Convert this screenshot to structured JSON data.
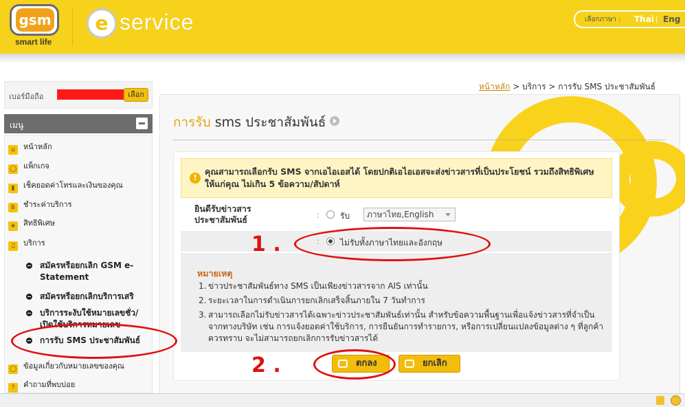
{
  "header": {
    "logo_text": "gsm",
    "tagline": "smart life",
    "service_brand": "service",
    "lang_label": "เลือกภาษา :",
    "lang_thai": "Thai",
    "lang_eng": "Eng"
  },
  "sidebar": {
    "phone_label": "เบอร์มือถือ",
    "phone_button": "เลือก",
    "menu_title": "เมนู",
    "items": [
      {
        "label": "หน้าหลัก",
        "icon": "home-icon"
      },
      {
        "label": "แพ็กเกจ",
        "icon": "chat-icon"
      },
      {
        "label": "เช็คยอดค่าโทรและเงินของคุณ",
        "icon": "phone-icon"
      },
      {
        "label": "ชำระค่าบริการ",
        "icon": "baht-icon"
      },
      {
        "label": "สิทธิพิเศษ",
        "icon": "star-icon"
      },
      {
        "label": "บริการ",
        "icon": "music-icon"
      }
    ],
    "subitems": [
      {
        "label": "สมัครหรือยกเลิก GSM e-Statement"
      },
      {
        "label": "สมัครหรือยกเลิกบริการเสริ"
      },
      {
        "label": "บริการระงับใช้หมายเลขชั่ว/เปิดใช้บริการหมายเลข"
      },
      {
        "label": "การรับ SMS ประชาสัมพันธ์"
      }
    ],
    "bottom_items": [
      {
        "label": "ข้อมูลเกี่ยวกับหมายเลขของคุณ",
        "icon": "chat-icon"
      },
      {
        "label": "คำถามที่พบบ่อย",
        "icon": "question-icon"
      }
    ]
  },
  "breadcrumb": {
    "home": "หน้าหลัก",
    "rest": " > บริการ > การรับ SMS ประชาสัมพันธ์"
  },
  "page": {
    "title_prefix": "การรับ",
    "title_rest": " sms ประชาสัมพันธ์",
    "notice": "คุณสามารถเลือกรับ SMS จากเอไอเอสได้ โดยปกติเอไอเอสจะส่งข่าวสารที่เป็นประโยชน์ รวมถึงสิทธิพิเศษให้แก่คุณ ไม่เกิน 5 ข้อความ/สัปดาห์",
    "field_label": "ยินดีรับข่าวสารประชาสัมพันธ์",
    "colon": ":",
    "option_receive": "รับ",
    "option_receive_select": "ภาษาไทย,English",
    "option_decline": "ไม่รับทั้งภาษาไทยและอังกฤษ",
    "remark_title": "หมายเหตุ",
    "remarks": [
      {
        "n": "1.",
        "text": "ข่าวประชาสัมพันธ์ทาง SMS เป็นเพียงข่าวสารจาก AIS เท่านั้น"
      },
      {
        "n": "2.",
        "text": "ระยะเวลาในการดำเนินการยกเลิกเสร็จสิ้นภายใน 7 วันทำการ"
      },
      {
        "n": "3.",
        "text": "สามารถเลือกไม่รับข่าวสารได้เฉพาะข่าวประชาสัมพันธ์เท่านั้น สำหรับข้อความพื้นฐานเพื่อแจ้งข่าวสารที่จำเป็นจากทางบริษัท เช่น การแจ้งยอดค่าใช้บริการ, การยืนยันการทำรายการ, หรือการเปลี่ยนแปลงข้อมูลต่าง ๆ ที่ลูกค้าควรทราบ จะไม่สามารถยกเลิกการรับข่าวสารได้"
      }
    ],
    "ok_button": "ตกลง",
    "cancel_button": "ยกเลิก"
  },
  "annotations": {
    "step1": "1 .",
    "step2": "2 ."
  },
  "colors": {
    "brand_yellow": "#f7d21a",
    "accent_orange": "#e5a40c",
    "annotation_red": "#e01010"
  }
}
